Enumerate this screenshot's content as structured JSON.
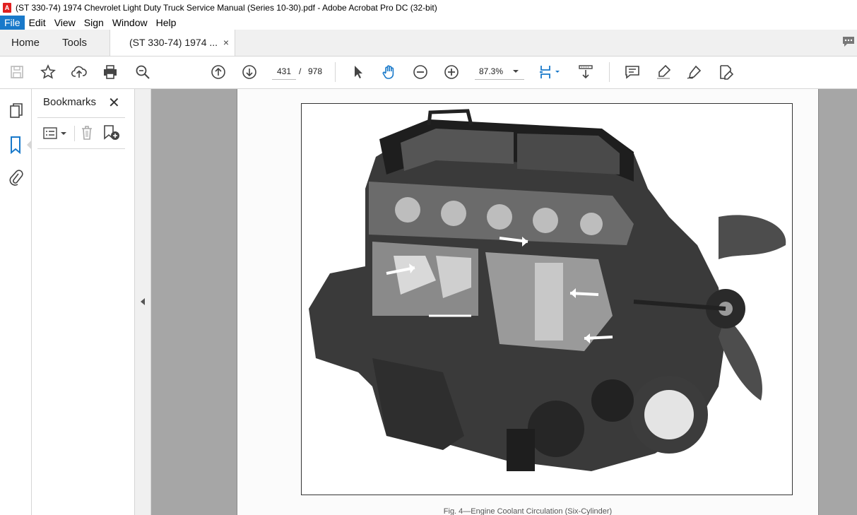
{
  "window": {
    "title": "(ST 330-74) 1974 Chevrolet Light Duty Truck Service Manual (Series 10-30).pdf - Adobe Acrobat Pro DC (32-bit)",
    "app_icon_label": "A"
  },
  "menu": {
    "file": "File",
    "edit": "Edit",
    "view": "View",
    "sign": "Sign",
    "window": "Window",
    "help": "Help"
  },
  "tabs": {
    "home": "Home",
    "tools": "Tools",
    "document": "(ST 330-74) 1974 ...",
    "close": "×"
  },
  "toolbar": {
    "page_current": "431",
    "page_sep": "/",
    "page_total": "978",
    "zoom": "87.3%"
  },
  "bookmarks": {
    "title": "Bookmarks",
    "close": "✕"
  },
  "document": {
    "caption": "Fig. 4—Engine Coolant Circulation (Six-Cylinder)"
  }
}
